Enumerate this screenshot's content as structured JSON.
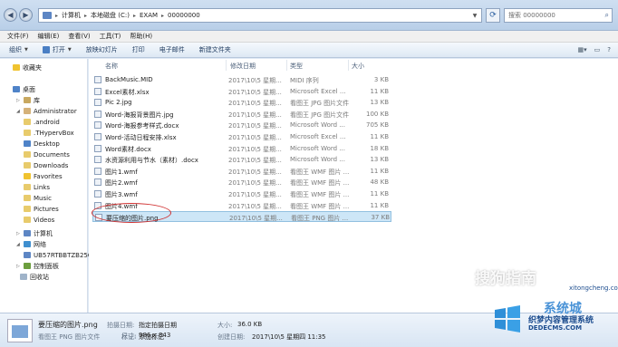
{
  "address": {
    "segments": [
      "计算机",
      "本地磁盘 (C:)",
      "EXAM",
      "00000000"
    ],
    "search_placeholder": "搜索 00000000"
  },
  "menu": [
    "文件(F)",
    "编辑(E)",
    "查看(V)",
    "工具(T)",
    "帮助(H)"
  ],
  "toolbar": {
    "organize": "组织",
    "open": "打开",
    "slideshow": "放映幻灯片",
    "print": "打印",
    "email": "电子邮件",
    "new_folder": "新建文件夹"
  },
  "nav": {
    "favorites": "收藏夹",
    "desktop": "桌面",
    "libraries": "库",
    "user": "Administrator",
    "folders": [
      ".android",
      ".THypervBox",
      "Desktop",
      "Documents",
      "Downloads",
      "Favorites",
      "Links",
      "Music",
      "Pictures",
      "Videos"
    ],
    "computer": "计算机",
    "network": "网络",
    "network_pc": "UB57RTBBTZB25C",
    "control_panel": "控制面板",
    "recycle_bin": "回收站"
  },
  "columns": {
    "name": "名称",
    "date": "修改日期",
    "type": "类型",
    "size": "大小"
  },
  "files": [
    {
      "name": "BackMusic.MID",
      "date": "2017\\10\\5 星期...",
      "type": "MIDI 序列",
      "size": "3 KB",
      "icon": "midi-icon"
    },
    {
      "name": "Excel素材.xlsx",
      "date": "2017\\10\\5 星期...",
      "type": "Microsoft Excel ...",
      "size": "11 KB",
      "icon": "excel-icon"
    },
    {
      "name": "Pic 2.jpg",
      "date": "2017\\10\\5 星期...",
      "type": "看图王 JPG 图片文件",
      "size": "13 KB",
      "icon": "image-icon"
    },
    {
      "name": "Word-海报背景图片.jpg",
      "date": "2017\\10\\5 星期...",
      "type": "看图王 JPG 图片文件",
      "size": "100 KB",
      "icon": "image-icon"
    },
    {
      "name": "Word-海报参考样式.docx",
      "date": "2017\\10\\5 星期...",
      "type": "Microsoft Word ...",
      "size": "705 KB",
      "icon": "word-icon"
    },
    {
      "name": "Word-活动日程安排.xlsx",
      "date": "2017\\10\\5 星期...",
      "type": "Microsoft Excel ...",
      "size": "11 KB",
      "icon": "excel-icon"
    },
    {
      "name": "Word素材.docx",
      "date": "2017\\10\\5 星期...",
      "type": "Microsoft Word ...",
      "size": "18 KB",
      "icon": "word-icon"
    },
    {
      "name": "水资源利用与节水（素材）.docx",
      "date": "2017\\10\\5 星期...",
      "type": "Microsoft Word ...",
      "size": "13 KB",
      "icon": "word-icon"
    },
    {
      "name": "图片1.wmf",
      "date": "2017\\10\\5 星期...",
      "type": "看图王 WMF 图片 ...",
      "size": "11 KB",
      "icon": "image-icon"
    },
    {
      "name": "图片2.wmf",
      "date": "2017\\10\\5 星期...",
      "type": "看图王 WMF 图片 ...",
      "size": "48 KB",
      "icon": "image-icon"
    },
    {
      "name": "图片3.wmf",
      "date": "2017\\10\\5 星期...",
      "type": "看图王 WMF 图片 ...",
      "size": "11 KB",
      "icon": "image-icon"
    },
    {
      "name": "图片4.wmf",
      "date": "2017\\10\\5 星期...",
      "type": "看图王 WMF 图片 ...",
      "size": "11 KB",
      "icon": "image-icon"
    },
    {
      "name": "要压缩的图片.png",
      "date": "2017\\10\\5 星期...",
      "type": "看图王 PNG 图片 ...",
      "size": "37 KB",
      "icon": "image-icon"
    }
  ],
  "details": {
    "filename": "要压缩的图片.png",
    "filetype": "看图王 PNG 图片文件",
    "date_taken_label": "拍摄日期:",
    "date_taken_value": "指定拍摄日期",
    "tags_label": "标记:",
    "tags_value": "添加标记",
    "size_label": "大小:",
    "size_value": "36.0 KB",
    "dimensions_label": "尺寸:",
    "dimensions_value": "986 x 843",
    "created_label": "创建日期:",
    "created_value": "2017\\10\\5 星期四 11:35"
  },
  "watermarks": {
    "sogou": "搜狗指南",
    "brand_cn": "织梦内容管理系统",
    "brand_url": "DEDECMS.COM",
    "xitong": "系统城",
    "xitong_url": "xitongcheng.com"
  }
}
